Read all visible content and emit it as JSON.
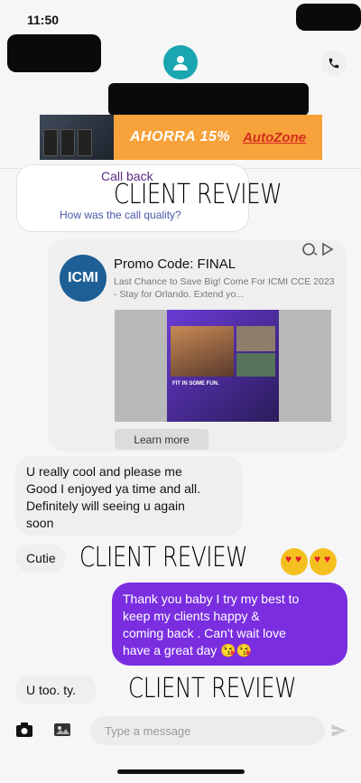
{
  "status_bar": {
    "time": "11:50"
  },
  "header": {
    "avatar_icon": "person-icon",
    "call_icon": "phone-icon"
  },
  "banner": {
    "promo_text": "AHORRA 15%",
    "brand": "AutoZone"
  },
  "messages": {
    "callback": {
      "title": "Call back",
      "subtitle": "How was the call quality?"
    },
    "promo_card": {
      "logo": "ICMI",
      "title": "Promo Code: FINAL",
      "description": "Last Chance to Save Big! Come For ICMI CCE 2023 - Stay for Orlando. Extend yo...",
      "image_caption": "FIT IN SOME FUN.",
      "button": "Learn more"
    },
    "incoming_1": [
      "U really cool and please me",
      "Good I enjoyed ya time and all.",
      "Definitely will seeing u again",
      "soon"
    ],
    "incoming_2": "Cutie",
    "outgoing_1": [
      "Thank you baby I try my best to",
      "keep my clients happy &",
      "coming back . Can't wait love",
      "have a great day 😘😘"
    ],
    "incoming_3": "U too. ty."
  },
  "overlays": {
    "review_1": "CLIENT REVIEW",
    "review_2": "CLIENT REVIEW",
    "review_3": "CLIENT REVIEW"
  },
  "composer": {
    "placeholder": "Type a message"
  }
}
